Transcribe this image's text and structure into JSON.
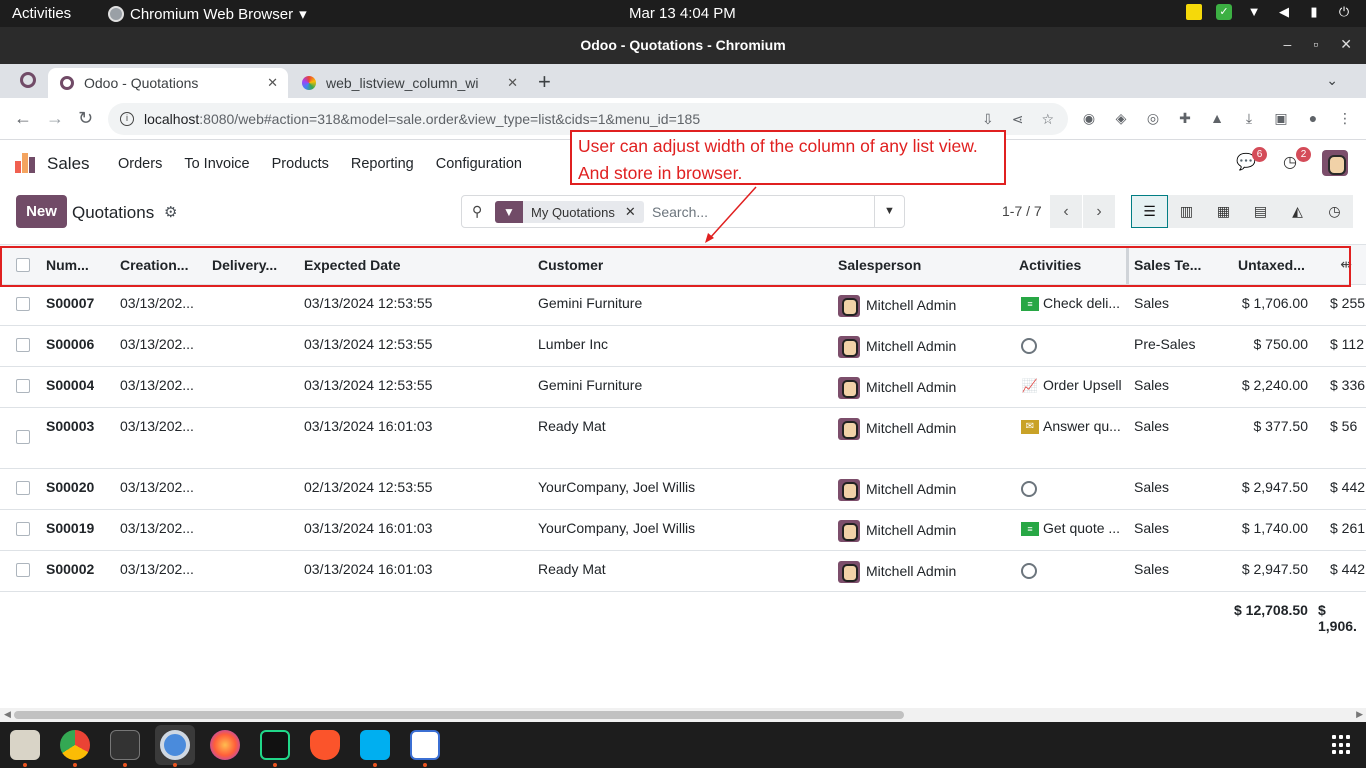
{
  "os": {
    "activities": "Activities",
    "app_name": "Chromium Web Browser",
    "clock": "Mar 13  4:04 PM"
  },
  "window": {
    "title": "Odoo - Quotations - Chromium"
  },
  "tabs": [
    {
      "label": "Odoo - Quotations",
      "active": true
    },
    {
      "label": "web_listview_column_wi",
      "active": false
    }
  ],
  "address": {
    "host": "localhost",
    "path": ":8080/web#action=318&model=sale.order&view_type=list&cids=1&menu_id=185"
  },
  "odoo_nav": {
    "app": "Sales",
    "menu": [
      "Orders",
      "To Invoice",
      "Products",
      "Reporting",
      "Configuration"
    ],
    "messages_count": "6",
    "activities_count": "2"
  },
  "control_panel": {
    "new_label": "New",
    "breadcrumb": "Quotations",
    "facet": "My Quotations",
    "search_placeholder": "Search...",
    "pager": "1-7 / 7"
  },
  "list": {
    "columns": [
      "Num...",
      "Creation...",
      "Delivery...",
      "Expected Date",
      "Customer",
      "Salesperson",
      "Activities",
      "Sales Te...",
      "Untaxed..."
    ],
    "rows": [
      {
        "number": "S00007",
        "creation": "03/13/202...",
        "delivery": "",
        "expected": "03/13/2024 12:53:55",
        "customer": "Gemini Furniture",
        "salesperson": "Mitchell Admin",
        "activity_icon": "todo-icon",
        "activity": "Check deli...",
        "team": "Sales",
        "untaxed": "$ 1,706.00",
        "total": "$ 255"
      },
      {
        "number": "S00006",
        "creation": "03/13/202...",
        "delivery": "",
        "expected": "03/13/2024 12:53:55",
        "customer": "Lumber Inc",
        "salesperson": "Mitchell Admin",
        "activity_icon": "clock-icon",
        "activity": "",
        "team": "Pre-Sales",
        "untaxed": "$ 750.00",
        "total": "$ 112"
      },
      {
        "number": "S00004",
        "creation": "03/13/202...",
        "delivery": "",
        "expected": "03/13/2024 12:53:55",
        "customer": "Gemini Furniture",
        "salesperson": "Mitchell Admin",
        "activity_icon": "upsell-chart-icon",
        "activity": "Order Upsell",
        "team": "Sales",
        "untaxed": "$ 2,240.00",
        "total": "$ 336"
      },
      {
        "number": "S00003",
        "creation": "03/13/202...",
        "delivery": "",
        "expected": "03/13/2024 16:01:03",
        "customer": "Ready Mat",
        "salesperson": "Mitchell Admin",
        "activity_icon": "envelope-icon",
        "activity": "Answer qu...",
        "team": "Sales",
        "untaxed": "$ 377.50",
        "total": "$ 56"
      },
      {
        "number": "S00020",
        "creation": "03/13/202...",
        "delivery": "",
        "expected": "02/13/2024 12:53:55",
        "customer": "YourCompany, Joel Willis",
        "salesperson": "Mitchell Admin",
        "activity_icon": "clock-icon",
        "activity": "",
        "team": "Sales",
        "untaxed": "$ 2,947.50",
        "total": "$ 442"
      },
      {
        "number": "S00019",
        "creation": "03/13/202...",
        "delivery": "",
        "expected": "03/13/2024 16:01:03",
        "customer": "YourCompany, Joel Willis",
        "salesperson": "Mitchell Admin",
        "activity_icon": "todo-icon",
        "activity": "Get quote ...",
        "team": "Sales",
        "untaxed": "$ 1,740.00",
        "total": "$ 261"
      },
      {
        "number": "S00002",
        "creation": "03/13/202...",
        "delivery": "",
        "expected": "03/13/2024 16:01:03",
        "customer": "Ready Mat",
        "salesperson": "Mitchell Admin",
        "activity_icon": "clock-icon",
        "activity": "",
        "team": "Sales",
        "untaxed": "$ 2,947.50",
        "total": "$ 442"
      }
    ],
    "totals": {
      "untaxed": "$ 12,708.50",
      "total": "$ 1,906."
    }
  },
  "annotation": {
    "line1": "User can adjust width of the column of any list view.",
    "line2": "And store in browser."
  },
  "colors": {
    "odoo_primary": "#714b67",
    "annotation": "#e02020",
    "badge": "#d44c59"
  }
}
